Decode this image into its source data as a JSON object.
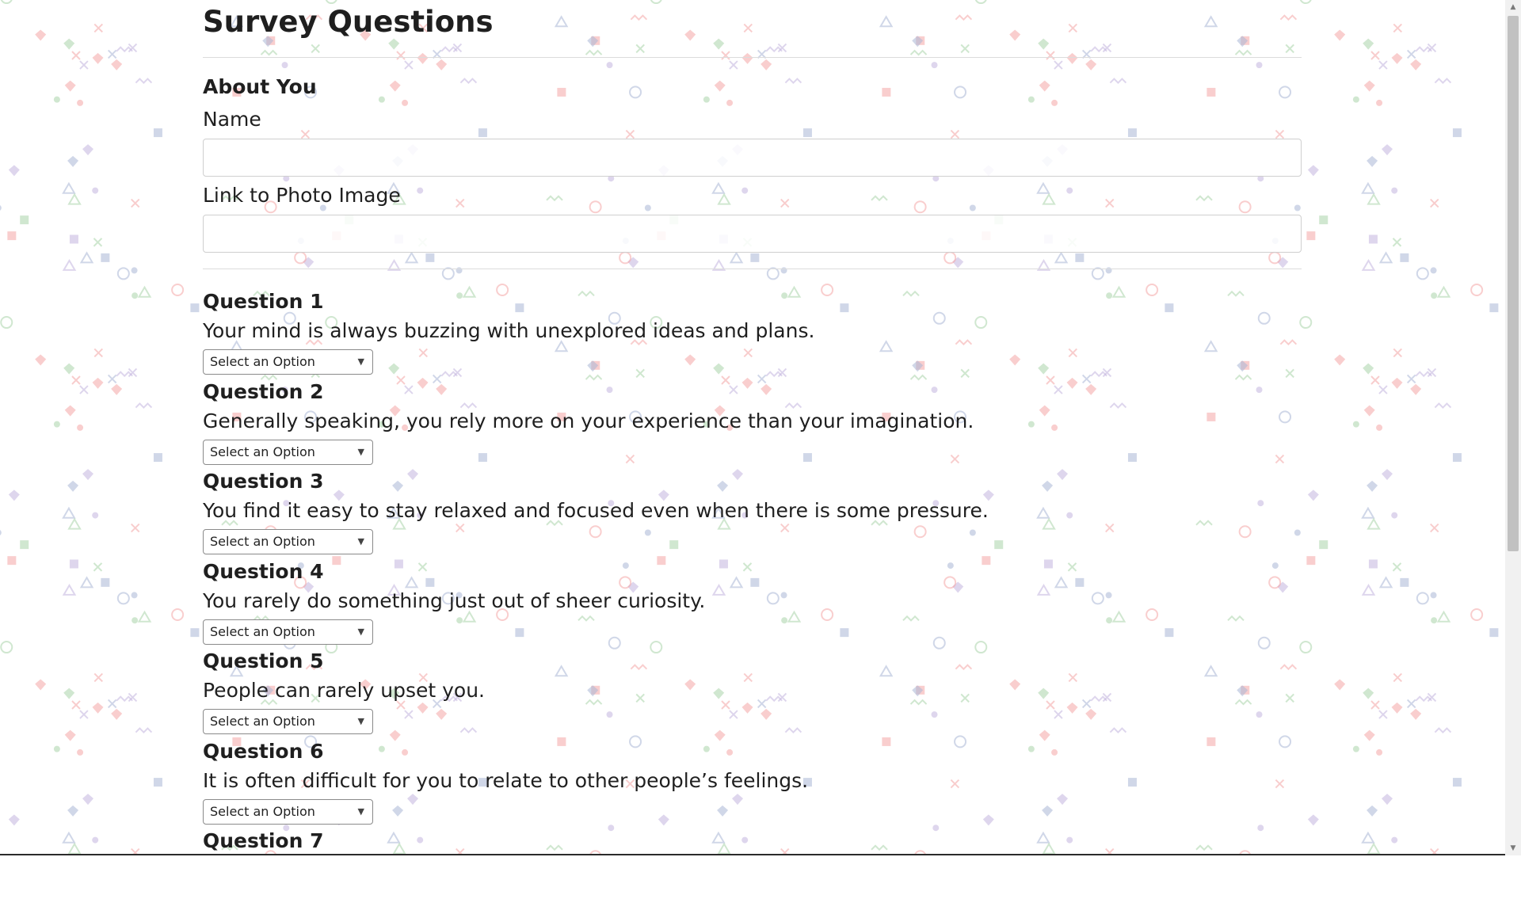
{
  "page": {
    "title": "Survey Questions"
  },
  "about": {
    "heading": "About You",
    "name_label": "Name",
    "name_value": "",
    "photo_label": "Link to Photo Image",
    "photo_value": ""
  },
  "questions": [
    {
      "title": "Question 1",
      "text": "Your mind is always buzzing with unexplored ideas and plans.",
      "selected": "Select an Option"
    },
    {
      "title": "Question 2",
      "text": "Generally speaking, you rely more on your experience than your imagination.",
      "selected": "Select an Option"
    },
    {
      "title": "Question 3",
      "text": "You find it easy to stay relaxed and focused even when there is some pressure.",
      "selected": "Select an Option"
    },
    {
      "title": "Question 4",
      "text": "You rarely do something just out of sheer curiosity.",
      "selected": "Select an Option"
    },
    {
      "title": "Question 5",
      "text": "People can rarely upset you.",
      "selected": "Select an Option"
    },
    {
      "title": "Question 6",
      "text": "It is often difficult for you to relate to other people’s feelings.",
      "selected": "Select an Option"
    },
    {
      "title": "Question 7",
      "text": "",
      "selected": ""
    }
  ],
  "colors": {
    "background": "#ffffff",
    "pattern_red": "#f4a6a6",
    "pattern_blue": "#aab6d6",
    "pattern_green": "#a9d4a9",
    "pattern_purple": "#c3b4de"
  },
  "icons": {
    "select_caret": "triangle-down-icon",
    "scroll_up": "triangle-up-icon",
    "scroll_down": "triangle-down-icon"
  }
}
